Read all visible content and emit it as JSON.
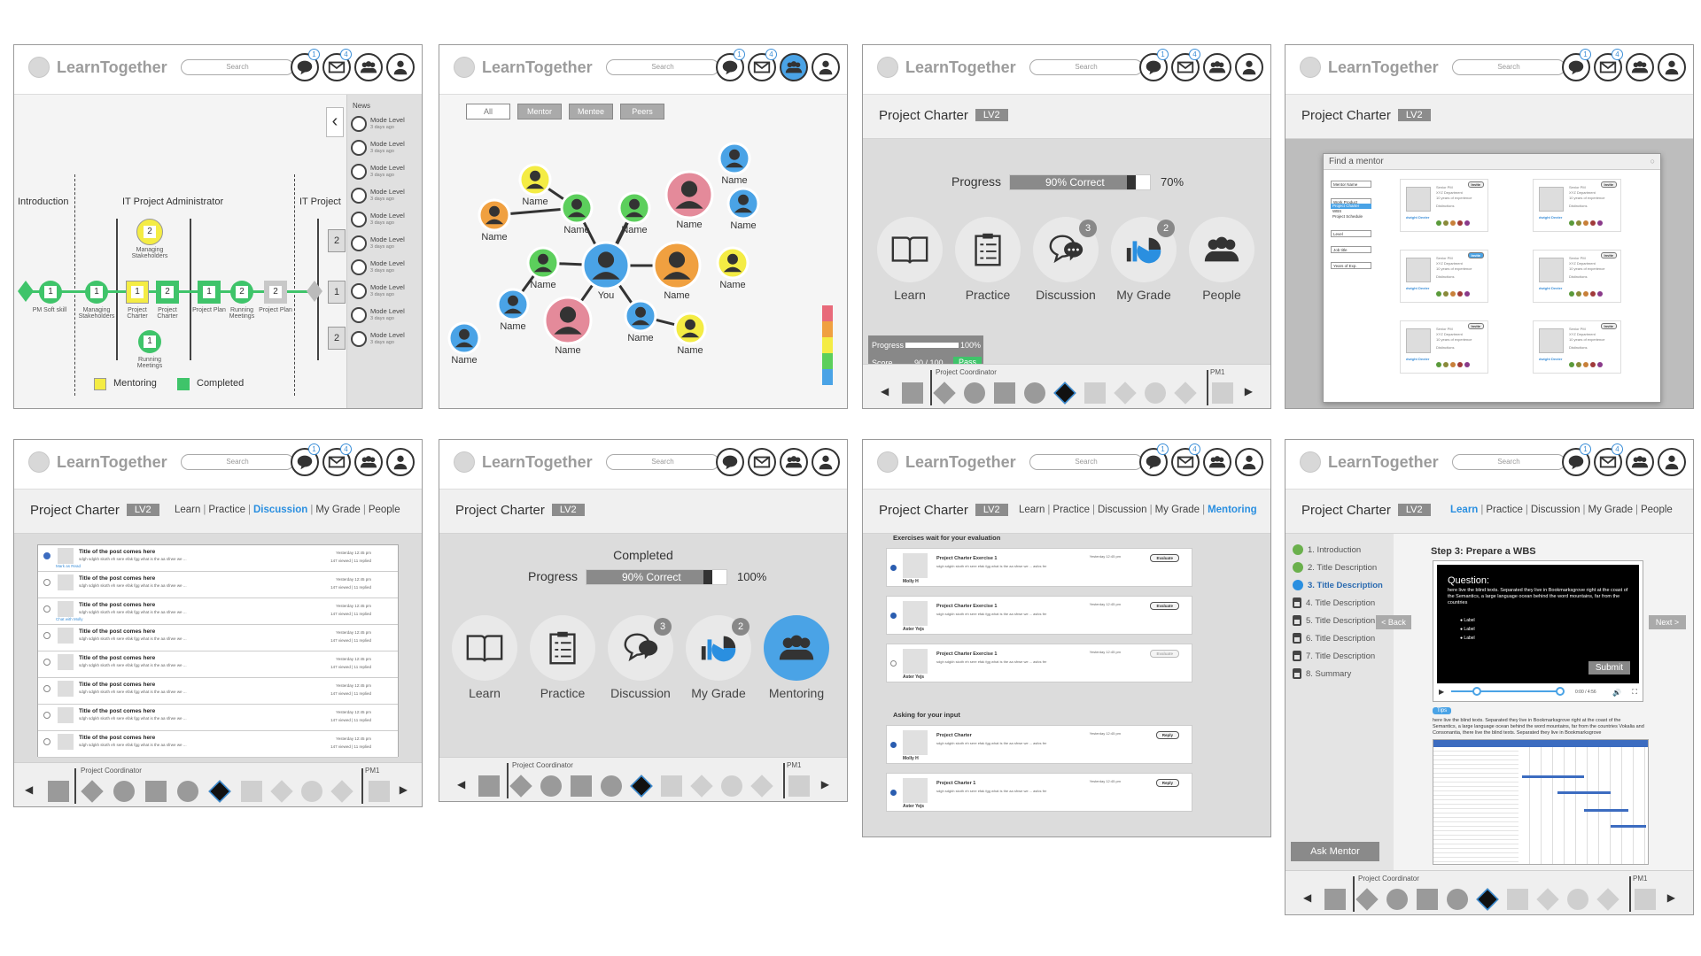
{
  "app": {
    "name": "LearnTogether",
    "search_placeholder": "Search"
  },
  "badges": {
    "messages": "1",
    "mail": "4"
  },
  "activities": {
    "learn": "Learn",
    "practice": "Practice",
    "discussion": "Discussion",
    "grade": "My Grade",
    "people": "People",
    "mentoring": "Mentoring",
    "discussion_badge": "3",
    "grade_badge": "2"
  },
  "charter": {
    "title": "Project Charter",
    "level": "LV2"
  },
  "tabs": {
    "learn": "Learn",
    "practice": "Practice",
    "discussion": "Discussion",
    "grade": "My Grade",
    "people": "People",
    "mentoring": "Mentoring",
    "sep": "|"
  },
  "bottom": {
    "coordinator": "Project Coordinator",
    "pm": "PM1"
  },
  "panel1": {
    "stages": [
      "Introduction",
      "IT Project Administrator",
      "IT Project"
    ],
    "nodes": [
      {
        "n": "1",
        "label": "PM Soft skill"
      },
      {
        "n": "1",
        "label": "Managing Stakeholders"
      },
      {
        "n": "1",
        "label": "Project Charter"
      },
      {
        "n": "2",
        "label": "Project Charter"
      },
      {
        "n": "1",
        "label": "Project Plan"
      },
      {
        "n": "2",
        "label": "Running Meetings"
      },
      {
        "n": "2",
        "label": "Project Plan"
      }
    ],
    "top_node": {
      "n": "2",
      "label": "Managing Stakeholders"
    },
    "bot_node": {
      "n": "1",
      "label": "Running Meetings"
    },
    "right_nums": [
      "2",
      "1",
      "2"
    ],
    "legend": {
      "mentoring": "Mentoring",
      "completed": "Completed"
    },
    "news_title": "News",
    "news": [
      {
        "t": "Mode Level",
        "d": "3 days ago"
      },
      {
        "t": "Mode Level",
        "d": "3 days ago"
      },
      {
        "t": "Mode Level",
        "d": "3 days ago"
      },
      {
        "t": "Mode Level",
        "d": "3 days ago"
      },
      {
        "t": "Mode Level",
        "d": "3 days ago"
      },
      {
        "t": "Mode Level",
        "d": "3 days ago"
      },
      {
        "t": "Mode Level",
        "d": "3 days ago"
      },
      {
        "t": "Mode Level",
        "d": "3 days ago"
      },
      {
        "t": "Mode Level",
        "d": "3 days ago"
      },
      {
        "t": "Mode Level",
        "d": "3 days ago"
      }
    ]
  },
  "panel2": {
    "filters": [
      "All",
      "Mentor",
      "Mentee",
      "Peers"
    ],
    "you": "You",
    "name": "Name",
    "colors": {
      "blue": "#4aa3e6",
      "green": "#5ccf5c",
      "orange": "#f0a040",
      "pink": "#e48a9a",
      "yellow": "#f4ec44"
    },
    "legend_colors": [
      "#e86a7a",
      "#f0a040",
      "#f4ec44",
      "#5ccf5c",
      "#4aa3e6"
    ]
  },
  "panel3": {
    "progress_label": "Progress",
    "progress_fill_text": "90% Correct",
    "progress_value": 0.9,
    "progress_pct": "70%",
    "tooltip": {
      "progress": "Progress",
      "progress_pct": "100%",
      "score": "Score",
      "score_val": "90 / 100",
      "pass": "Pass"
    }
  },
  "panel4": {
    "dialog_title": "Find a mentor",
    "filters": [
      "Mentor Name",
      "Work Product",
      "Project Charter",
      "WBS",
      "Project Schedule",
      "Level",
      "Job title",
      "Years of Exp."
    ],
    "cards": [
      {
        "invite": "Invite",
        "title": "Senior PM",
        "dept": "XYZ Department",
        "years": "10 years of experience",
        "dist": "Distinctions",
        "name": "dwight Dexter"
      },
      {
        "invite": "Invite",
        "title": "Senior PM",
        "dept": "XYZ Department",
        "years": "10 years of experience",
        "dist": "Distinctions",
        "name": "dwight Dexter"
      },
      {
        "invite": "Invite",
        "title": "Senior PM",
        "dept": "XYZ Department",
        "years": "10 years of experience",
        "dist": "Distinctions",
        "name": "dwight Dexter"
      },
      {
        "invite": "Invite",
        "title": "Senior PM",
        "dept": "XYZ Department",
        "years": "10 years of experience",
        "dist": "Distinctions",
        "name": "dwight Dexter"
      },
      {
        "invite": "Invite",
        "title": "Senior PM",
        "dept": "XYZ Department",
        "years": "10 years of experience",
        "dist": "Distinctions",
        "name": "dwight Dexter"
      },
      {
        "invite": "Invite",
        "title": "Senior PM",
        "dept": "XYZ Department",
        "years": "10 years of experience",
        "dist": "Distinctions",
        "name": "dwight Dexter"
      }
    ],
    "dist_colors": [
      "#5a9a3a",
      "#8a8a3a",
      "#c8803a",
      "#a03a3a",
      "#8a3a8a"
    ]
  },
  "panel5": {
    "posts": [
      {
        "t": "Title of the post comes here",
        "d": "sdgh sdgkh skoth eh sere efak fgg what is the aa sfrwe we ...",
        "time": "Yesterday 12:45 pm",
        "meta": "147 viewed  |  11 replied",
        "link": "Mark as Read"
      },
      {
        "t": "Title of the post comes here",
        "d": "sdgh sdgkh skoth eh sere efak fgg what is the aa sfrwe we ...",
        "time": "Yesterday 12:45 pm",
        "meta": "147 viewed  |  11 replied",
        "link": ""
      },
      {
        "t": "Title of the post comes here",
        "d": "sdgh sdgkh skoth eh sere efak fgg what is the aa sfrwe we ...",
        "time": "Yesterday 12:45 pm",
        "meta": "147 viewed  |  11 replied",
        "link": "Chat with Molly"
      },
      {
        "t": "Title of the post comes here",
        "d": "sdgh sdgkh skoth eh sere efak fgg what is the aa sfrwe we ...",
        "time": "Yesterday 12:45 pm",
        "meta": "147 viewed  |  11 replied",
        "link": ""
      },
      {
        "t": "Title of the post comes here",
        "d": "sdgh sdgkh skoth eh sere efak fgg what is the aa sfrwe we ...",
        "time": "Yesterday 12:45 pm",
        "meta": "147 viewed  |  11 replied",
        "link": ""
      },
      {
        "t": "Title of the post comes here",
        "d": "sdgh sdgkh skoth eh sere efak fgg what is the aa sfrwe we ...",
        "time": "Yesterday 12:45 pm",
        "meta": "147 viewed  |  11 replied",
        "link": ""
      },
      {
        "t": "Title of the post comes here",
        "d": "sdgh sdgkh skoth eh sere efak fgg what is the aa sfrwe we ...",
        "time": "Yesterday 12:45 pm",
        "meta": "147 viewed  |  11 replied",
        "link": ""
      },
      {
        "t": "Title of the post comes here",
        "d": "sdgh sdgkh skoth eh sere efak fgg what is the aa sfrwe we ...",
        "time": "Yesterday 12:45 pm",
        "meta": "147 viewed  |  11 replied",
        "link": ""
      }
    ]
  },
  "panel6": {
    "completed": "Completed",
    "progress_label": "Progress",
    "progress_fill_text": "90% Correct",
    "progress_value": 0.9,
    "progress_pct": "100%"
  },
  "panel7": {
    "section1": "Exercises wait for your evaluation",
    "section2": "Asking for your input",
    "ex1": [
      {
        "t": "Project Charter Exercise 1",
        "d": "sdgh sdgkh skoth eh sere efak fgg what is the aa sfrwe we ... asfcs fer",
        "time": "Yesterday 12:45 pm",
        "btn": "Evaluate",
        "name": "Molly H"
      },
      {
        "t": "Project Charter Exercise 1",
        "d": "sdgh sdgkh skoth eh sere efak fgg what is the aa sfrwe we ... asfcs fer",
        "time": "Yesterday 12:45 pm",
        "btn": "Evaluate",
        "name": "Aster Yejs"
      },
      {
        "t": "Project Charter Exercise 1",
        "d": "sdgh sdgkh skoth eh sere efak fgg what is the aa sfrwe we ... asfcs fer",
        "time": "Yesterday 12:45 pm",
        "btn": "Evaluate",
        "name": "Aster Yejs"
      }
    ],
    "ex2": [
      {
        "t": "Project Charter",
        "d": "sdgh sdgkh skoth eh sere efak fgg what is the aa sfrwe we ... asfcs fer",
        "time": "Yesterday 12:45 pm",
        "btn": "Reply",
        "name": "Molly H"
      },
      {
        "t": "Project Charter 1",
        "d": "sdgh sdgkh skoth eh sere efak fgg what is the aa sfrwe we ... asfcs fer",
        "time": "Yesterday 12:45 pm",
        "btn": "Reply",
        "name": "Aster Yejs"
      }
    ]
  },
  "panel8": {
    "steps": [
      {
        "n": "1. Introduction",
        "s": "ok"
      },
      {
        "n": "2. Title Description",
        "s": "ok"
      },
      {
        "n": "3. Title Description",
        "s": "cur"
      },
      {
        "n": "4. Title Description",
        "s": "lk"
      },
      {
        "n": "5. Title Description",
        "s": "lk"
      },
      {
        "n": "6. Title Description",
        "s": "lk"
      },
      {
        "n": "7. Title Description",
        "s": "lk"
      },
      {
        "n": "8. Summary",
        "s": "lk"
      }
    ],
    "step_title": "Step 3:  Prepare a WBS",
    "question_title": "Question:",
    "question_text": "here live the blind texts. Separated they live in Bookmarksgrove right at the coast of the Semantics, a large language ocean behind the word mountains, far from the countries",
    "options": [
      "Label",
      "Label",
      "Label"
    ],
    "submit": "Submit",
    "back": "< Back",
    "next": "Next >",
    "time": "0:00 / 4:56",
    "tips_label": "Tips",
    "tips_text": "here live the blind texts. Separated they live in Bookmarksgrove right at the coast of the Semantics, a large language ocean behind the word mountains, far from the countries Vokalia and Consonantia, there live the blind texts. Separated they live in Bookmarksgrove",
    "ask": "Ask Mentor"
  }
}
